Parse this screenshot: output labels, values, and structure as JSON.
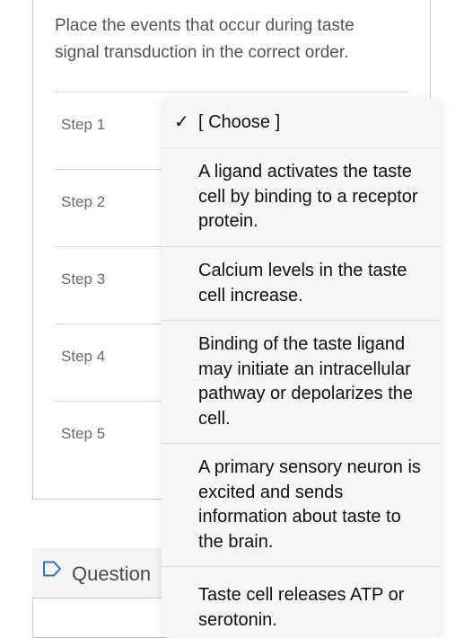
{
  "question": {
    "prompt": "Place the events that occur during taste signal transduction in the correct order."
  },
  "steps": [
    {
      "label": "Step 1"
    },
    {
      "label": "Step 2"
    },
    {
      "label": "Step 3"
    },
    {
      "label": "Step 4"
    },
    {
      "label": "Step 5"
    }
  ],
  "dropdown": {
    "selected_index": 0,
    "check_glyph": "✓",
    "options": [
      {
        "label": "[ Choose ]"
      },
      {
        "label": "A ligand activates the taste cell by binding to a receptor protein."
      },
      {
        "label": "Calcium levels in the taste cell increase."
      },
      {
        "label": "Binding of the taste ligand may initiate an intracellular pathway or depolarizes the cell."
      },
      {
        "label": "A primary sensory neuron is excited and sends information about taste to the brain."
      },
      {
        "label": "Taste cell releases ATP or serotonin."
      }
    ]
  },
  "next_question": {
    "label": "Question",
    "flag_icon": "flag-outline-icon"
  }
}
